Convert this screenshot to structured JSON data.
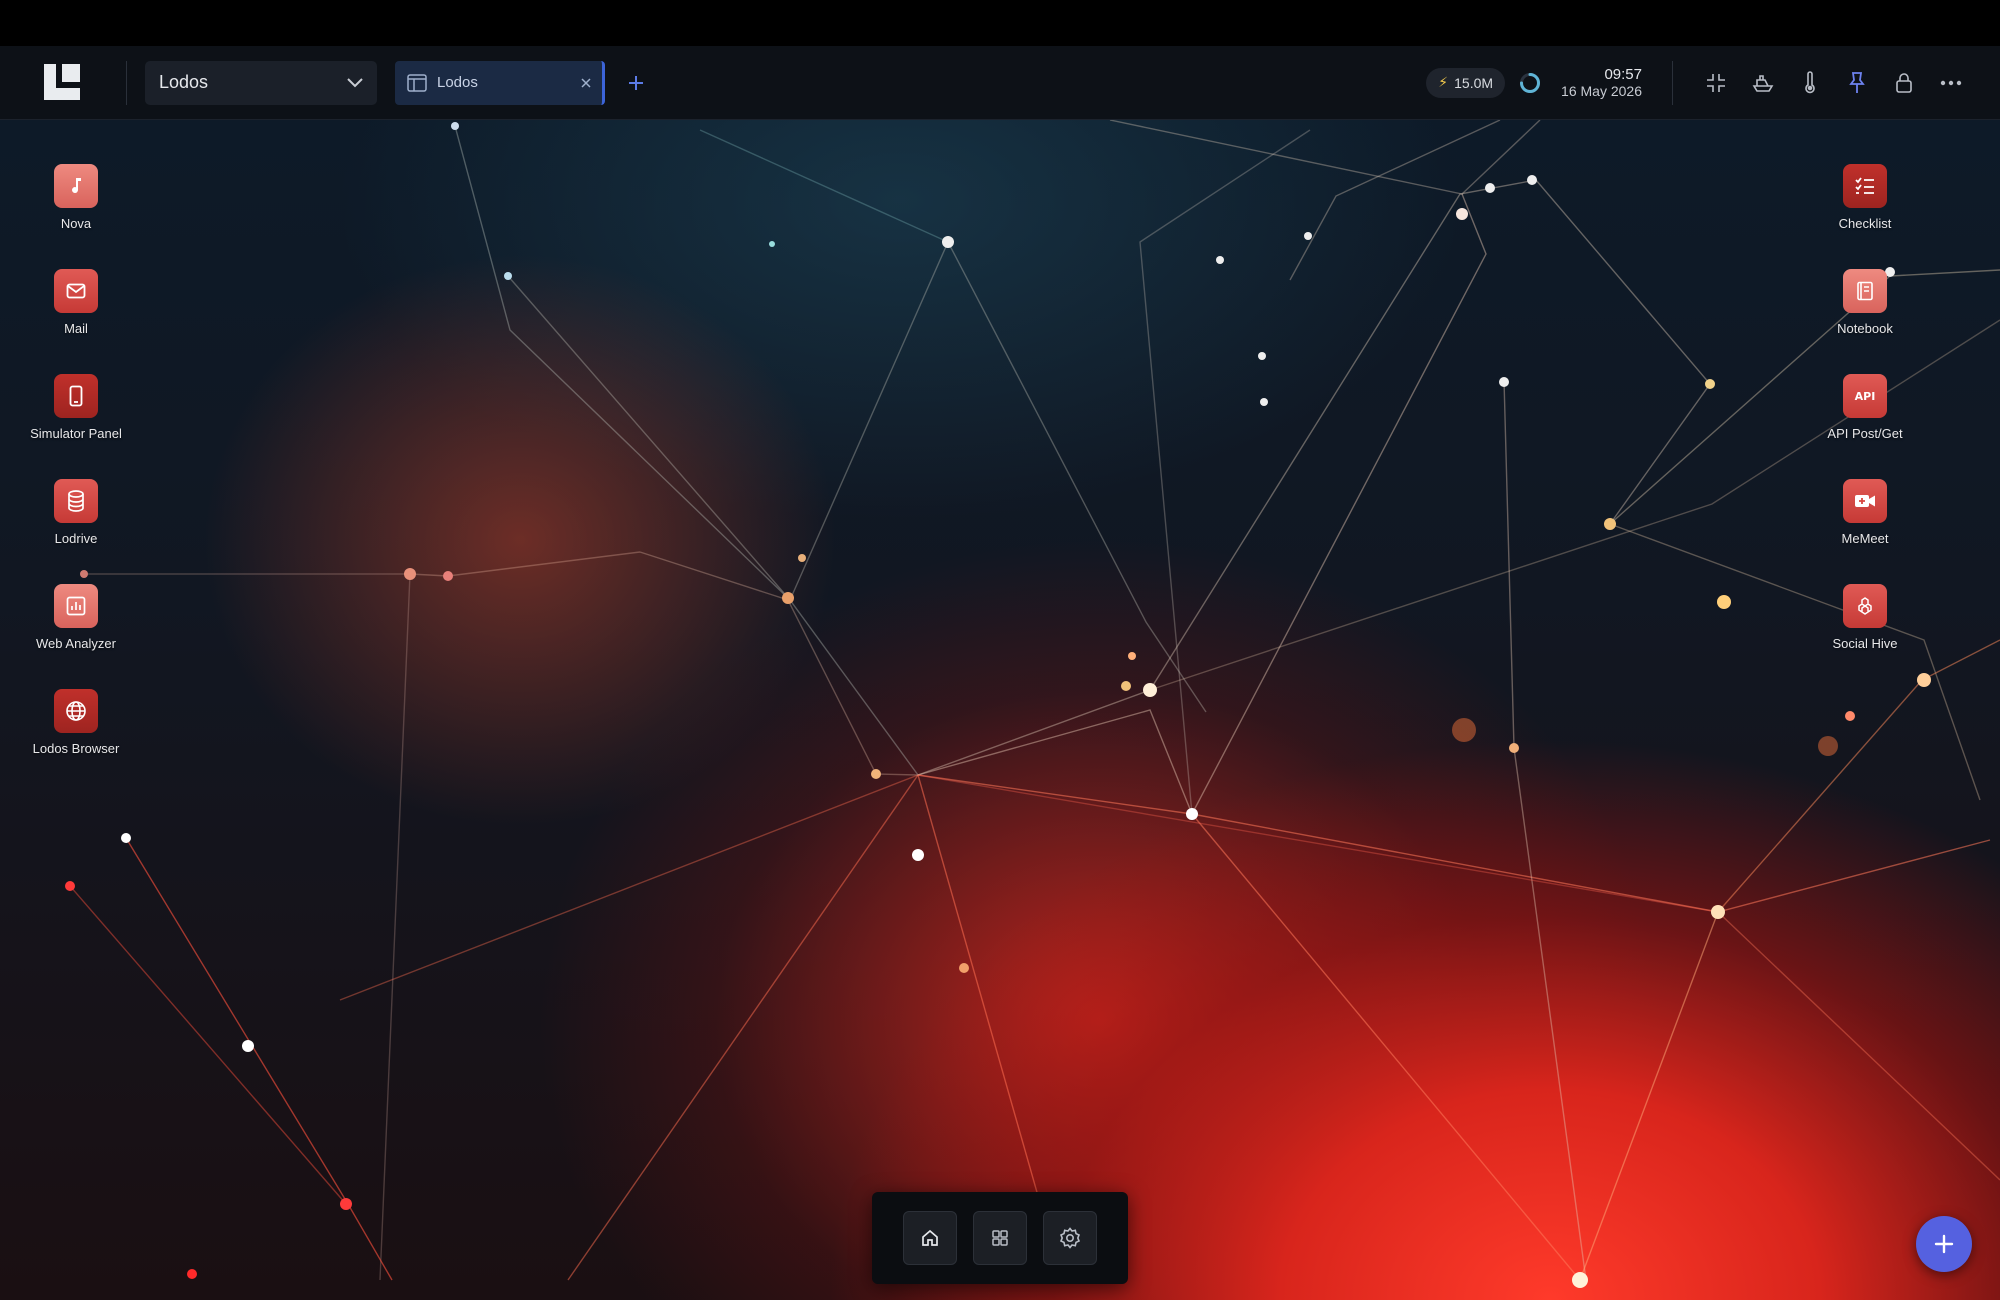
{
  "workspace": {
    "selected": "Lodos"
  },
  "tabs": [
    {
      "label": "Lodos"
    }
  ],
  "status": {
    "energy": "15.0M",
    "time": "09:57",
    "date": "16 May 2026"
  },
  "toolbar_icons": [
    "collapse-icon",
    "boat-icon",
    "thermometer-icon",
    "pin-icon",
    "lock-icon",
    "more-icon"
  ],
  "apps_left": [
    {
      "label": "Nova",
      "icon": "music-note-icon"
    },
    {
      "label": "Mail",
      "icon": "mail-icon"
    },
    {
      "label": "Simulator Panel",
      "icon": "phone-icon"
    },
    {
      "label": "Lodrive",
      "icon": "database-icon"
    },
    {
      "label": "Web Analyzer",
      "icon": "chart-icon"
    },
    {
      "label": "Lodos Browser",
      "icon": "globe-icon"
    }
  ],
  "apps_right": [
    {
      "label": "Checklist",
      "icon": "checklist-icon"
    },
    {
      "label": "Notebook",
      "icon": "notebook-icon"
    },
    {
      "label": "API Post/Get",
      "icon": "api-icon",
      "badge": "API"
    },
    {
      "label": "MeMeet",
      "icon": "video-icon"
    },
    {
      "label": "Social Hive",
      "icon": "hive-icon"
    }
  ],
  "dock": [
    "home-icon",
    "grid-icon",
    "settings-icon"
  ],
  "colors": {
    "accent": "#5561e0",
    "tab_border": "#3c64d8",
    "app_red": "#d9463f"
  }
}
